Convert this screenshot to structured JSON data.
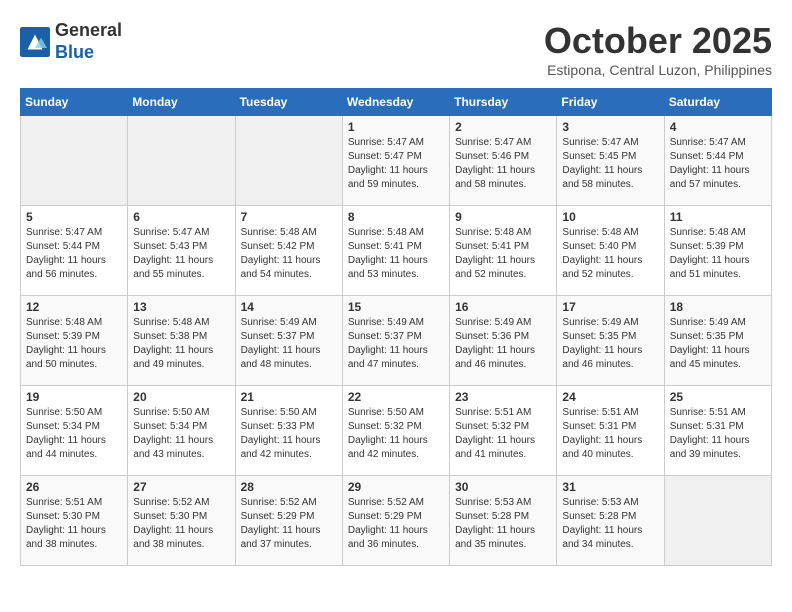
{
  "header": {
    "logo_line1": "General",
    "logo_line2": "Blue",
    "month_title": "October 2025",
    "location": "Estipona, Central Luzon, Philippines"
  },
  "weekdays": [
    "Sunday",
    "Monday",
    "Tuesday",
    "Wednesday",
    "Thursday",
    "Friday",
    "Saturday"
  ],
  "weeks": [
    [
      {
        "day": "",
        "sunrise": "",
        "sunset": "",
        "daylight": ""
      },
      {
        "day": "",
        "sunrise": "",
        "sunset": "",
        "daylight": ""
      },
      {
        "day": "",
        "sunrise": "",
        "sunset": "",
        "daylight": ""
      },
      {
        "day": "1",
        "sunrise": "Sunrise: 5:47 AM",
        "sunset": "Sunset: 5:47 PM",
        "daylight": "Daylight: 11 hours and 59 minutes."
      },
      {
        "day": "2",
        "sunrise": "Sunrise: 5:47 AM",
        "sunset": "Sunset: 5:46 PM",
        "daylight": "Daylight: 11 hours and 58 minutes."
      },
      {
        "day": "3",
        "sunrise": "Sunrise: 5:47 AM",
        "sunset": "Sunset: 5:45 PM",
        "daylight": "Daylight: 11 hours and 58 minutes."
      },
      {
        "day": "4",
        "sunrise": "Sunrise: 5:47 AM",
        "sunset": "Sunset: 5:44 PM",
        "daylight": "Daylight: 11 hours and 57 minutes."
      }
    ],
    [
      {
        "day": "5",
        "sunrise": "Sunrise: 5:47 AM",
        "sunset": "Sunset: 5:44 PM",
        "daylight": "Daylight: 11 hours and 56 minutes."
      },
      {
        "day": "6",
        "sunrise": "Sunrise: 5:47 AM",
        "sunset": "Sunset: 5:43 PM",
        "daylight": "Daylight: 11 hours and 55 minutes."
      },
      {
        "day": "7",
        "sunrise": "Sunrise: 5:48 AM",
        "sunset": "Sunset: 5:42 PM",
        "daylight": "Daylight: 11 hours and 54 minutes."
      },
      {
        "day": "8",
        "sunrise": "Sunrise: 5:48 AM",
        "sunset": "Sunset: 5:41 PM",
        "daylight": "Daylight: 11 hours and 53 minutes."
      },
      {
        "day": "9",
        "sunrise": "Sunrise: 5:48 AM",
        "sunset": "Sunset: 5:41 PM",
        "daylight": "Daylight: 11 hours and 52 minutes."
      },
      {
        "day": "10",
        "sunrise": "Sunrise: 5:48 AM",
        "sunset": "Sunset: 5:40 PM",
        "daylight": "Daylight: 11 hours and 52 minutes."
      },
      {
        "day": "11",
        "sunrise": "Sunrise: 5:48 AM",
        "sunset": "Sunset: 5:39 PM",
        "daylight": "Daylight: 11 hours and 51 minutes."
      }
    ],
    [
      {
        "day": "12",
        "sunrise": "Sunrise: 5:48 AM",
        "sunset": "Sunset: 5:39 PM",
        "daylight": "Daylight: 11 hours and 50 minutes."
      },
      {
        "day": "13",
        "sunrise": "Sunrise: 5:48 AM",
        "sunset": "Sunset: 5:38 PM",
        "daylight": "Daylight: 11 hours and 49 minutes."
      },
      {
        "day": "14",
        "sunrise": "Sunrise: 5:49 AM",
        "sunset": "Sunset: 5:37 PM",
        "daylight": "Daylight: 11 hours and 48 minutes."
      },
      {
        "day": "15",
        "sunrise": "Sunrise: 5:49 AM",
        "sunset": "Sunset: 5:37 PM",
        "daylight": "Daylight: 11 hours and 47 minutes."
      },
      {
        "day": "16",
        "sunrise": "Sunrise: 5:49 AM",
        "sunset": "Sunset: 5:36 PM",
        "daylight": "Daylight: 11 hours and 46 minutes."
      },
      {
        "day": "17",
        "sunrise": "Sunrise: 5:49 AM",
        "sunset": "Sunset: 5:35 PM",
        "daylight": "Daylight: 11 hours and 46 minutes."
      },
      {
        "day": "18",
        "sunrise": "Sunrise: 5:49 AM",
        "sunset": "Sunset: 5:35 PM",
        "daylight": "Daylight: 11 hours and 45 minutes."
      }
    ],
    [
      {
        "day": "19",
        "sunrise": "Sunrise: 5:50 AM",
        "sunset": "Sunset: 5:34 PM",
        "daylight": "Daylight: 11 hours and 44 minutes."
      },
      {
        "day": "20",
        "sunrise": "Sunrise: 5:50 AM",
        "sunset": "Sunset: 5:34 PM",
        "daylight": "Daylight: 11 hours and 43 minutes."
      },
      {
        "day": "21",
        "sunrise": "Sunrise: 5:50 AM",
        "sunset": "Sunset: 5:33 PM",
        "daylight": "Daylight: 11 hours and 42 minutes."
      },
      {
        "day": "22",
        "sunrise": "Sunrise: 5:50 AM",
        "sunset": "Sunset: 5:32 PM",
        "daylight": "Daylight: 11 hours and 42 minutes."
      },
      {
        "day": "23",
        "sunrise": "Sunrise: 5:51 AM",
        "sunset": "Sunset: 5:32 PM",
        "daylight": "Daylight: 11 hours and 41 minutes."
      },
      {
        "day": "24",
        "sunrise": "Sunrise: 5:51 AM",
        "sunset": "Sunset: 5:31 PM",
        "daylight": "Daylight: 11 hours and 40 minutes."
      },
      {
        "day": "25",
        "sunrise": "Sunrise: 5:51 AM",
        "sunset": "Sunset: 5:31 PM",
        "daylight": "Daylight: 11 hours and 39 minutes."
      }
    ],
    [
      {
        "day": "26",
        "sunrise": "Sunrise: 5:51 AM",
        "sunset": "Sunset: 5:30 PM",
        "daylight": "Daylight: 11 hours and 38 minutes."
      },
      {
        "day": "27",
        "sunrise": "Sunrise: 5:52 AM",
        "sunset": "Sunset: 5:30 PM",
        "daylight": "Daylight: 11 hours and 38 minutes."
      },
      {
        "day": "28",
        "sunrise": "Sunrise: 5:52 AM",
        "sunset": "Sunset: 5:29 PM",
        "daylight": "Daylight: 11 hours and 37 minutes."
      },
      {
        "day": "29",
        "sunrise": "Sunrise: 5:52 AM",
        "sunset": "Sunset: 5:29 PM",
        "daylight": "Daylight: 11 hours and 36 minutes."
      },
      {
        "day": "30",
        "sunrise": "Sunrise: 5:53 AM",
        "sunset": "Sunset: 5:28 PM",
        "daylight": "Daylight: 11 hours and 35 minutes."
      },
      {
        "day": "31",
        "sunrise": "Sunrise: 5:53 AM",
        "sunset": "Sunset: 5:28 PM",
        "daylight": "Daylight: 11 hours and 34 minutes."
      },
      {
        "day": "",
        "sunrise": "",
        "sunset": "",
        "daylight": ""
      }
    ]
  ]
}
